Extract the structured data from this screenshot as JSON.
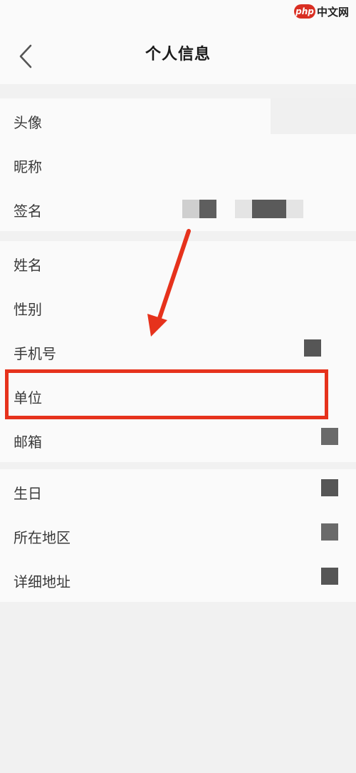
{
  "header": {
    "title": "个人信息",
    "back_icon": "chevron-left-icon"
  },
  "watermark": {
    "logo": "php",
    "text": "中文网"
  },
  "groups": [
    {
      "items": [
        {
          "label": "头像"
        },
        {
          "label": "昵称"
        },
        {
          "label": "签名"
        }
      ]
    },
    {
      "items": [
        {
          "label": "姓名"
        },
        {
          "label": "性别"
        },
        {
          "label": "手机号"
        },
        {
          "label": "单位"
        },
        {
          "label": "邮箱"
        }
      ]
    },
    {
      "items": [
        {
          "label": "生日"
        },
        {
          "label": "所在地区"
        },
        {
          "label": "详细地址"
        }
      ]
    }
  ],
  "annotation": {
    "arrow_color": "#e6321c",
    "highlight_color": "#e6321c",
    "highlighted_item": "单位"
  }
}
